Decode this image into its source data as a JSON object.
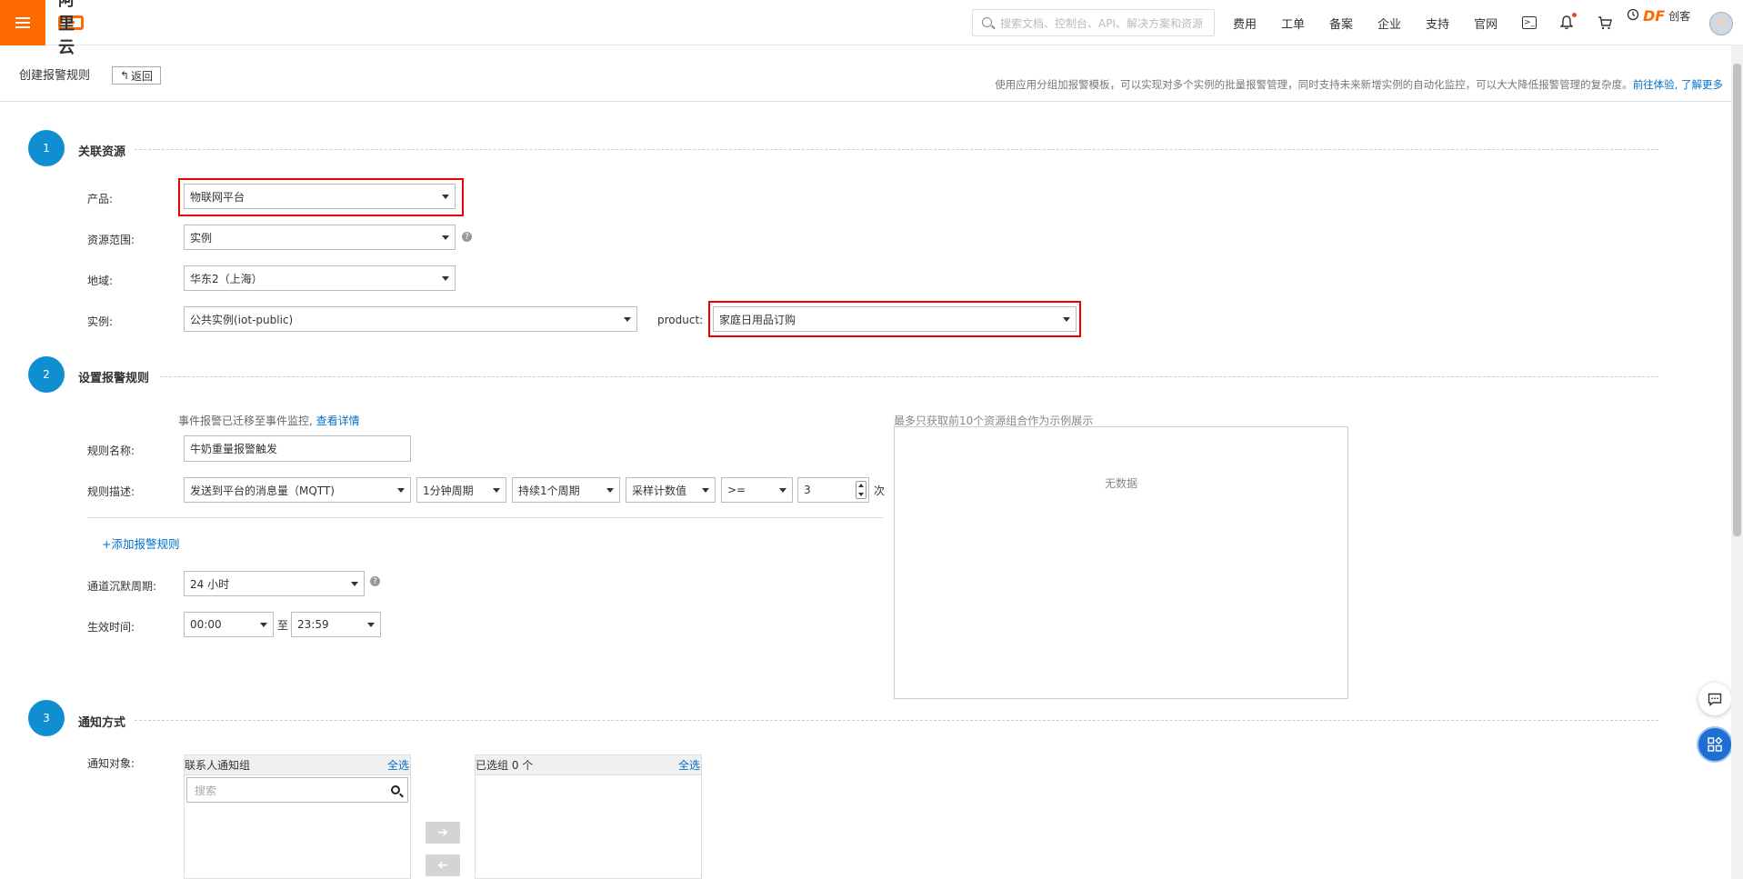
{
  "topbar": {
    "logo_text": "阿里云",
    "search_placeholder": "搜索文档、控制台、API、解决方案和资源",
    "nav": [
      "费用",
      "工单",
      "备案",
      "企业",
      "支持",
      "官网"
    ],
    "df_logo": "DF",
    "df_text": "创客"
  },
  "header": {
    "title": "创建报警规则",
    "back_label": "返回",
    "tip_text": "使用应用分组加报警模板，可以实现对多个实例的批量报警管理，同时支持未来新增实例的自动化监控，可以大大降低报警管理的复杂度。",
    "tip_link1": "前往体验,",
    "tip_link2": "了解更多"
  },
  "section1": {
    "step": "1",
    "title": "关联资源",
    "product_label": "产品:",
    "product_value": "物联网平台",
    "scope_label": "资源范围:",
    "scope_value": "实例",
    "region_label": "地域:",
    "region_value": "华东2（上海）",
    "instance_label": "实例:",
    "instance_value": "公共实例(iot-public)",
    "product2_label": "product:",
    "product2_value": "家庭日用品订购"
  },
  "section2": {
    "step": "2",
    "title": "设置报警规则",
    "event_tip": "事件报警已迁移至事件监控,",
    "event_link": "查看详情",
    "preview_tip": "最多只获取前10个资源组合作为示例展示",
    "preview_empty": "无数据",
    "rule_name_label": "规则名称:",
    "rule_name_value": "牛奶重量报警触发",
    "rule_desc_label": "规则描述:",
    "metric": "发送到平台的消息量（MQTT)",
    "period": "1分钟周期",
    "duration": "持续1个周期",
    "method": "采样计数值",
    "operator": ">=",
    "threshold": "3",
    "unit": "次",
    "add_rule": "+添加报警规则",
    "silence_label": "通道沉默周期:",
    "silence_value": "24 小时",
    "effective_label": "生效时间:",
    "start_time": "00:00",
    "to": "至",
    "end_time": "23:59"
  },
  "section3": {
    "step": "3",
    "title": "通知方式",
    "target_label": "通知对象:",
    "left_title": "联系人通知组",
    "left_select_all": "全选",
    "search_placeholder": "搜索",
    "right_title": "已选组 0 个",
    "right_select_all": "全选"
  }
}
